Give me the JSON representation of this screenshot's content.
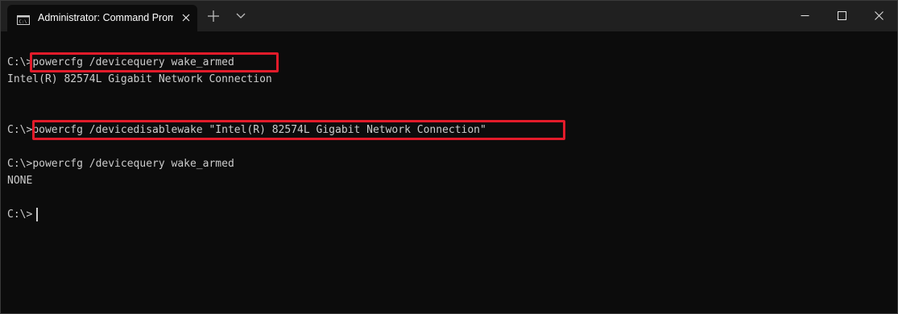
{
  "window": {
    "tab_title": "Administrator: Command Prompt",
    "tab_icon": "cmd-icon",
    "buttons": {
      "close_tab": "close-icon",
      "new_tab": "plus-icon",
      "dropdown": "chevron-down-icon",
      "minimize": "minimize-icon",
      "maximize": "maximize-icon",
      "close": "close-icon"
    }
  },
  "terminal": {
    "lines": [
      {
        "prompt": "C:\\>",
        "command": "powercfg /devicequery wake_armed"
      },
      {
        "output": "Intel(R) 82574L Gigabit Network Connection"
      },
      {
        "prompt": "C:\\>",
        "command": "powercfg /devicedisablewake \"Intel(R) 82574L Gigabit Network Connection\""
      },
      {
        "prompt": "C:\\>",
        "command": "powercfg /devicequery wake_armed"
      },
      {
        "output": "NONE"
      },
      {
        "prompt": "C:\\>",
        "command": ""
      }
    ]
  },
  "colors": {
    "background": "#0c0c0c",
    "titlebar": "#202020",
    "text": "#cccccc",
    "highlight": "#e21b2a"
  }
}
